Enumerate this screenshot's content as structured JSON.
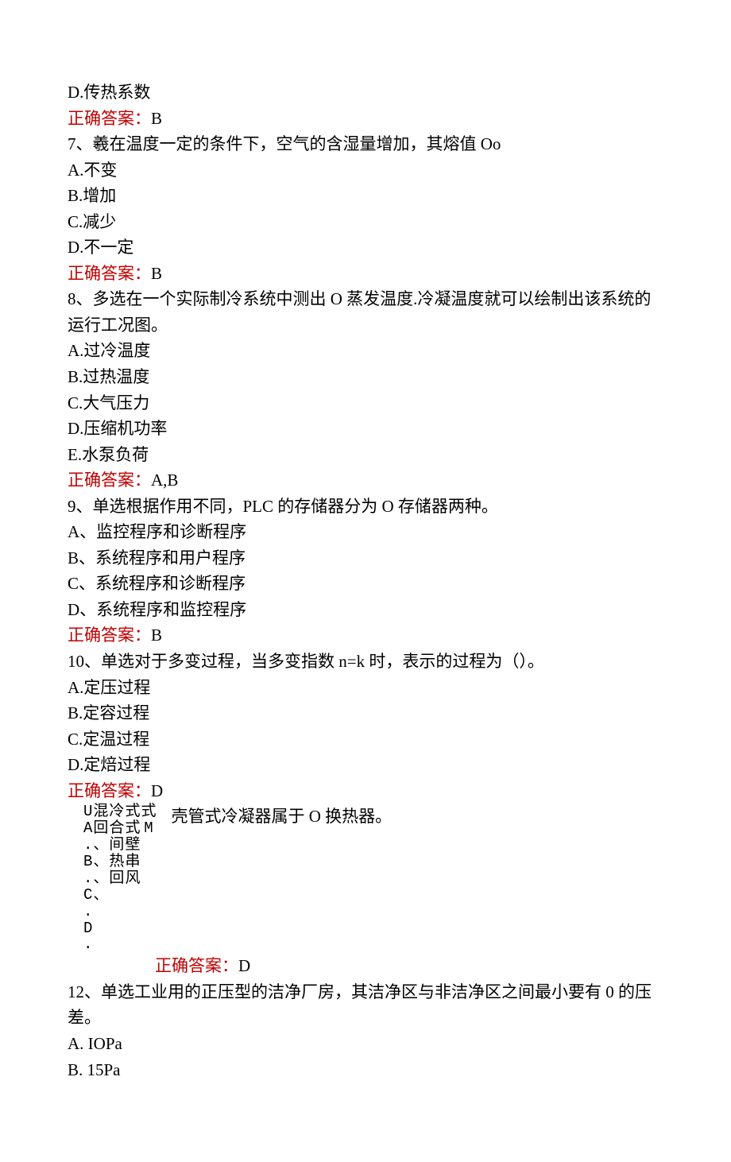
{
  "q6": {
    "optD": "D.传热系数",
    "answerLabel": "正确答案：",
    "answerValue": "B"
  },
  "q7": {
    "stem": "7、羲在温度一定的条件下，空气的含湿量增加，其熔值 Oo",
    "optA": "A.不变",
    "optB": "B.增加",
    "optC": "C.减少",
    "optD": "D.不一定",
    "answerLabel": "正确答案：",
    "answerValue": "B"
  },
  "q8": {
    "stem": "8、多选在一个实际制冷系统中测出 O 蒸发温度.冷凝温度就可以绘制出该系统的运行工况图。",
    "optA": "A.过冷温度",
    "optB": "B.过热温度",
    "optC": "C.大气压力",
    "optD": "D.压缩机功率",
    "optE": "E.水泵负荷",
    "answerLabel": "正确答案：",
    "answerValue": "A,B"
  },
  "q9": {
    "stem": "9、单选根据作用不同，PLC 的存储器分为 O 存储器两种。",
    "optA": "A、监控程序和诊断程序",
    "optB": "B、系统程序和用户程序",
    "optC": "C、系统程序和诊断程序",
    "optD": "D、系统程序和监控程序",
    "answerLabel": "正确答案：",
    "answerValue": "B"
  },
  "q10": {
    "stem": "10、单选对于多变过程，当多变指数 n=k 时，表示的过程为（）。",
    "optA": "A.定压过程",
    "optB": "B.定容过程",
    "optC": "C.定温过程",
    "optD": "D.定焙过程",
    "answerLabel": "正确答案：",
    "answerValue": "D"
  },
  "q11": {
    "rightText": "壳管式冷凝器属于 O 换热器。",
    "vcols": [
      [
        "U",
        "A",
        ".",
        "B",
        ".",
        "C",
        ".",
        "D",
        "."
      ],
      [
        "混",
        "回",
        "、",
        "、",
        "、",
        "、"
      ],
      [
        "冷",
        "合",
        "间",
        "热",
        "回"
      ],
      [
        "",
        "式",
        "式",
        "壁",
        "串",
        "风"
      ],
      [
        "",
        "",
        "",
        "式",
        "",
        "M"
      ]
    ],
    "answerLabel": "正确答案：",
    "answerValue": "D"
  },
  "q12": {
    "stem": "12、单选工业用的正压型的洁净厂房，其洁净区与非洁净区之间最小要有 0 的压差。",
    "optA": "A. IOPa",
    "optB": "B. 15Pa"
  }
}
